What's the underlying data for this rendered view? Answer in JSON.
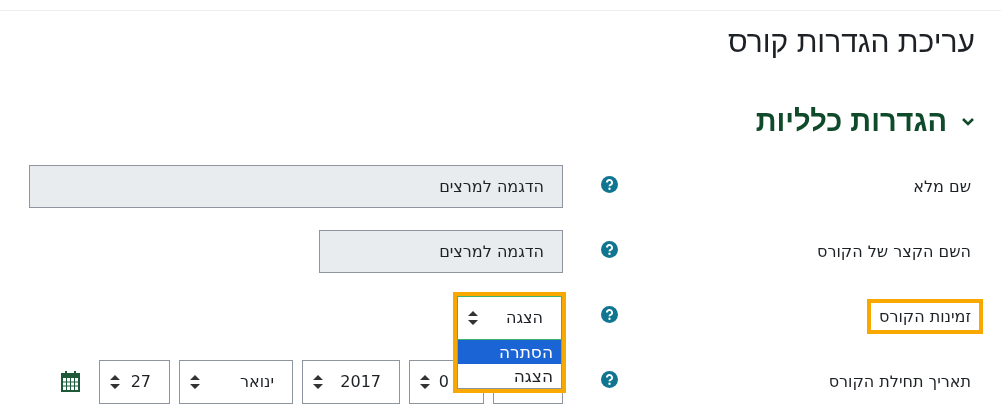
{
  "page_title": "עריכת הגדרות קורס",
  "section": {
    "title": "הגדרות כלליות",
    "expanded": true
  },
  "fields": [
    {
      "kind": "text",
      "label": "שם מלא",
      "value": "הדגמה למרצים",
      "highlighted": false
    },
    {
      "kind": "text",
      "label": "השם הקצר של הקורס",
      "value": "הדגמה למרצים",
      "highlighted": false
    },
    {
      "kind": "select",
      "label": "זמינות הקורס",
      "value": "הצגה",
      "highlighted": true,
      "open": true,
      "options": [
        {
          "label": "הסתרה",
          "hovered": true
        },
        {
          "label": "הצגה",
          "hovered": false
        }
      ]
    },
    {
      "kind": "date",
      "label": "תאריך תחילת הקורס",
      "highlighted": false,
      "parts": [
        {
          "value": "0"
        },
        {
          "value": "2017"
        },
        {
          "value": "ינואר"
        },
        {
          "value": "27"
        }
      ]
    }
  ]
}
